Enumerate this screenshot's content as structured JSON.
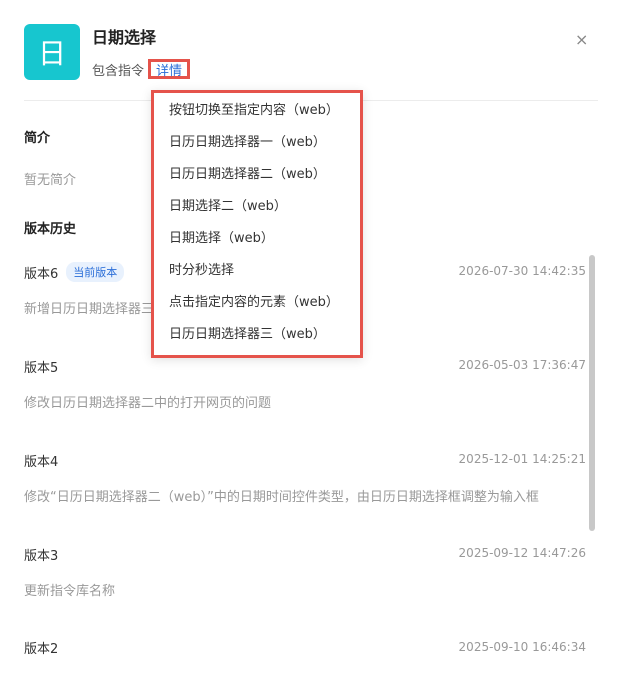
{
  "header": {
    "icon_glyph": "日",
    "title": "日期选择",
    "includes_label": "包含指令",
    "detail_link": "详情",
    "close_glyph": "×"
  },
  "dropdown": {
    "items": [
      "按钮切换至指定内容（web）",
      "日历日期选择器一（web）",
      "日历日期选择器二（web）",
      "日期选择二（web）",
      "日期选择（web）",
      "时分秒选择",
      "点击指定内容的元素（web）",
      "日历日期选择器三（web）"
    ]
  },
  "intro": {
    "heading": "简介",
    "text": "暂无简介"
  },
  "history": {
    "heading": "版本历史",
    "current_badge": "当前版本",
    "versions": [
      {
        "name": "版本6",
        "time": "2026-07-30 14:42:35",
        "desc": "新增日历日期选择器三（web）"
      },
      {
        "name": "版本5",
        "time": "2026-05-03 17:36:47",
        "desc": "修改日历日期选择器二中的打开网页的问题"
      },
      {
        "name": "版本4",
        "time": "2025-12-01 14:25:21",
        "desc": "修改“日历日期选择器二（web）”中的日期时间控件类型，由日历日期选择框调整为输入框"
      },
      {
        "name": "版本3",
        "time": "2025-09-12 14:47:26",
        "desc": "更新指令库名称"
      },
      {
        "name": "版本2",
        "time": "2025-09-10 16:46:34",
        "desc": ""
      }
    ]
  },
  "colors": {
    "icon_bg": "#17c6cf",
    "link": "#2a6ed8",
    "highlight_border": "#e5534b"
  }
}
